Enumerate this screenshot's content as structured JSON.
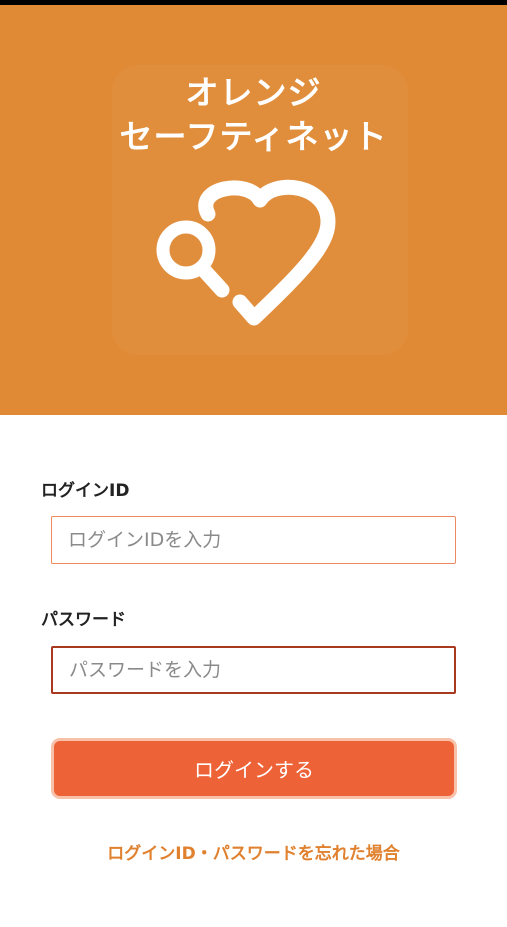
{
  "colors": {
    "hero_background": "#e08a35",
    "primary_button": "#ee6238",
    "link": "#e0812f",
    "text": "#222222"
  },
  "brand": {
    "name_line1": "オレンジ",
    "name_line2": "セーフティネット",
    "logo_icon": "heart-magnifier-check-icon"
  },
  "login_form": {
    "login_id": {
      "label": "ログインID",
      "value": "",
      "placeholder": "ログインIDを入力"
    },
    "password": {
      "label": "パスワード",
      "value": "",
      "placeholder": "パスワードを入力"
    },
    "submit_label": "ログインする",
    "forgot_link": "ログインID・パスワードを忘れた場合"
  }
}
